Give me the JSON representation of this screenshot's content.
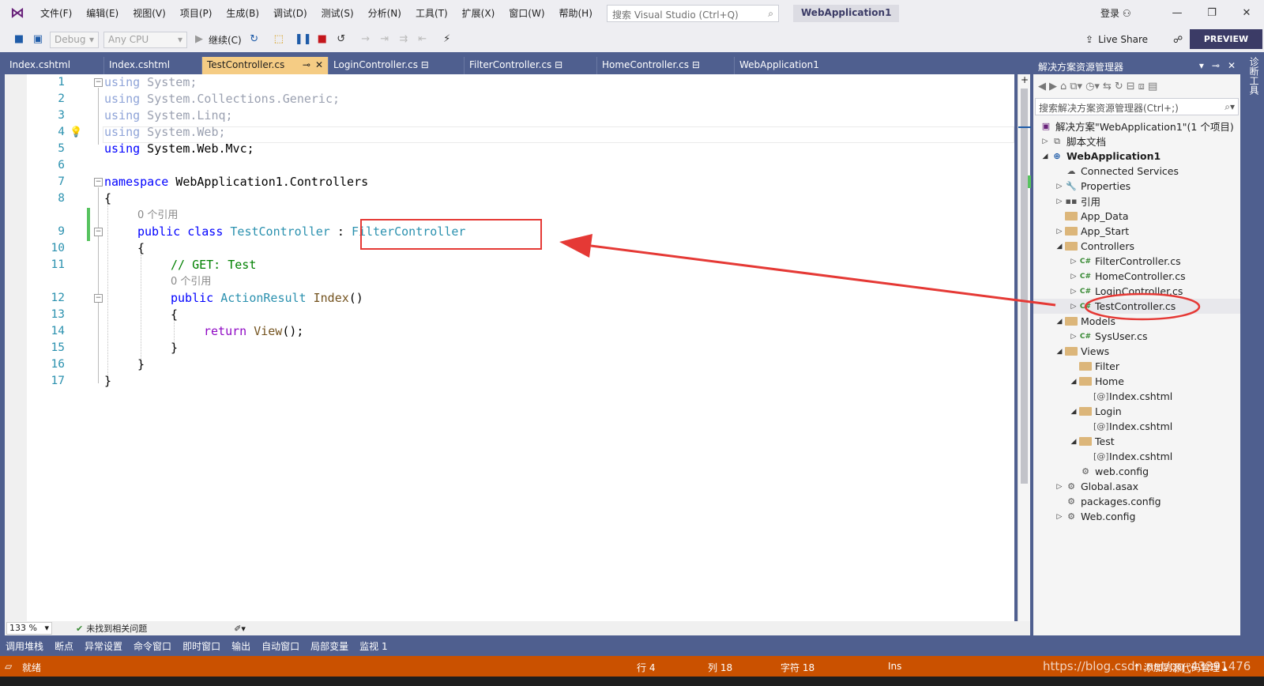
{
  "menubar": {
    "items": [
      "文件(F)",
      "编辑(E)",
      "视图(V)",
      "项目(P)",
      "生成(B)",
      "调试(D)",
      "测试(S)",
      "分析(N)",
      "工具(T)",
      "扩展(X)",
      "窗口(W)",
      "帮助(H)"
    ],
    "search_placeholder": "搜索 Visual Studio (Ctrl+Q)",
    "solution_name": "WebApplication1",
    "login": "登录"
  },
  "toolbar": {
    "config": "Debug",
    "platform": "Any CPU",
    "continue_label": "继续(C)",
    "live_share": "Live Share",
    "preview": "PREVIEW"
  },
  "tabs": [
    {
      "label": "Index.cshtml"
    },
    {
      "label": "Index.cshtml"
    },
    {
      "label": "TestController.cs",
      "active": true
    },
    {
      "label": "LoginController.cs"
    },
    {
      "label": "FilterController.cs"
    },
    {
      "label": "HomeController.cs"
    },
    {
      "label": "WebApplication1"
    }
  ],
  "tab_pin_icon": "pin-icon",
  "tab_lock_icon": "lock-icon",
  "code": {
    "line_numbers": [
      "1",
      "2",
      "3",
      "4",
      "5",
      "6",
      "7",
      "8",
      "",
      "9",
      "10",
      "11",
      "",
      "12",
      "13",
      "14",
      "15",
      "16",
      "17"
    ],
    "l1_kw": "using",
    "l1_rest": " System;",
    "l2_kw": "using",
    "l2_rest": " System.Collections.Generic;",
    "l3_kw": "using",
    "l3_rest": " System.Linq;",
    "l4_kw": "using",
    "l4_rest": " System.Web;",
    "l5_kw": "using",
    "l5_rest": " System.Web.Mvc;",
    "l7_kw": "namespace",
    "l7_rest": " WebApplication1.Controllers",
    "l8": "{",
    "ref_count_1": "0 个引用",
    "l9_kw1": "public",
    "l9_kw2": "class",
    "l9_type": "TestController",
    "l9_colon": " : ",
    "l9_base": "FilterController",
    "l10": "{",
    "l11_comment": "// GET: Test",
    "ref_count_2": "0 个引用",
    "l12_kw": "public",
    "l12_type": "ActionResult",
    "l12_method": "Index",
    "l12_paren": "()",
    "l13": "{",
    "l14_kw": "return",
    "l14_method": "View",
    "l14_rest": "();",
    "l15": "}",
    "l16": "}",
    "l17": "}"
  },
  "editor_status": {
    "zoom": "133 %",
    "issues": "未找到相关问题"
  },
  "solution_explorer": {
    "title": "解决方案资源管理器",
    "search_placeholder": "搜索解决方案资源管理器(Ctrl+;)",
    "nodes": [
      {
        "label": "解决方案\"WebApplication1\"(1 个项目)",
        "icon": "solution-icon"
      },
      {
        "label": "脚本文档",
        "icon": "script-docs-icon"
      },
      {
        "label": "WebApplication1",
        "icon": "web-project-icon"
      },
      {
        "label": "Connected Services",
        "icon": "connected-services-icon"
      },
      {
        "label": "Properties",
        "icon": "wrench-icon"
      },
      {
        "label": "引用",
        "icon": "references-icon"
      },
      {
        "label": "App_Data",
        "icon": "folder-icon"
      },
      {
        "label": "App_Start",
        "icon": "folder-icon"
      },
      {
        "label": "Controllers",
        "icon": "folder-icon"
      },
      {
        "label": "FilterController.cs",
        "icon": "csharp-file-icon"
      },
      {
        "label": "HomeController.cs",
        "icon": "csharp-file-icon"
      },
      {
        "label": "LoginController.cs",
        "icon": "csharp-file-icon"
      },
      {
        "label": "TestController.cs",
        "icon": "csharp-file-icon"
      },
      {
        "label": "Models",
        "icon": "folder-icon"
      },
      {
        "label": "SysUser.cs",
        "icon": "csharp-file-icon"
      },
      {
        "label": "Views",
        "icon": "folder-icon"
      },
      {
        "label": "Filter",
        "icon": "folder-icon"
      },
      {
        "label": "Home",
        "icon": "folder-icon"
      },
      {
        "label": "Index.cshtml",
        "icon": "razor-file-icon"
      },
      {
        "label": "Login",
        "icon": "folder-icon"
      },
      {
        "label": "Index.cshtml",
        "icon": "razor-file-icon"
      },
      {
        "label": "Test",
        "icon": "folder-icon"
      },
      {
        "label": "Index.cshtml",
        "icon": "razor-file-icon"
      },
      {
        "label": "web.config",
        "icon": "config-file-icon"
      },
      {
        "label": "Global.asax",
        "icon": "config-file-icon"
      },
      {
        "label": "packages.config",
        "icon": "config-file-icon"
      },
      {
        "label": "Web.config",
        "icon": "config-file-icon"
      }
    ]
  },
  "side_tab": "诊断工具",
  "bottom_tabs": [
    "调用堆栈",
    "断点",
    "异常设置",
    "命令窗口",
    "即时窗口",
    "输出",
    "自动窗口",
    "局部变量",
    "监视 1"
  ],
  "status": {
    "ready": "就绪",
    "line": "行 4",
    "col": "列 18",
    "char": "字符 18",
    "ins": "Ins",
    "add_source": "添加到源代码管理",
    "watermark": "https://blog.csdn.net/qq_43391476"
  },
  "colors": {
    "accent": "#68217a",
    "chrome": "#eeeef2",
    "panel_blue": "#4f5f8f",
    "active_tab": "#f5cc84",
    "status_orange": "#ca5100",
    "annotation_red": "#e53935",
    "keyword": "#0000ff",
    "type": "#2b91af",
    "comment": "#008000"
  }
}
